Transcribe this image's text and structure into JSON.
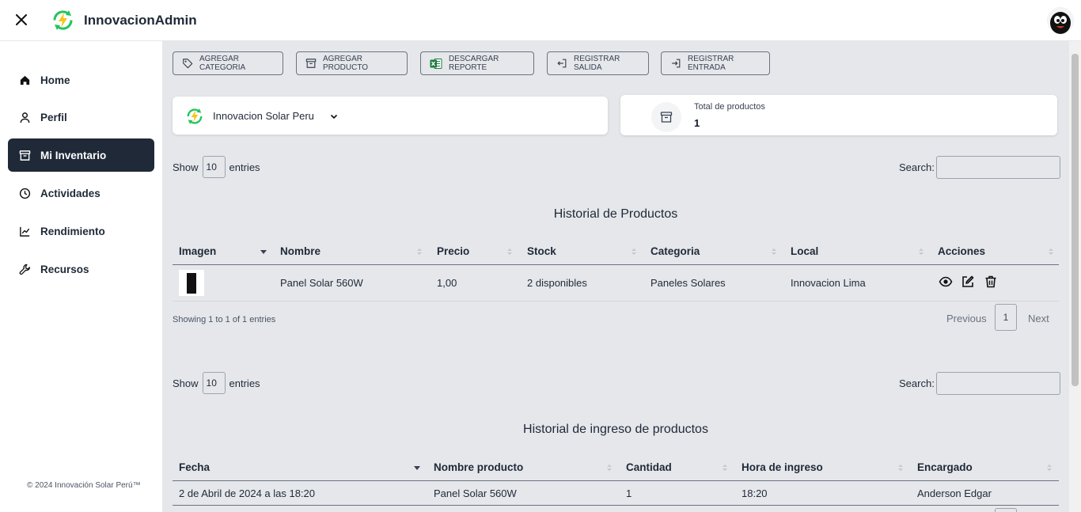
{
  "header": {
    "brand_name": "InnovacionAdmin"
  },
  "sidebar": {
    "items": [
      {
        "label": "Home",
        "icon": "home-icon"
      },
      {
        "label": "Perfil",
        "icon": "user-icon"
      },
      {
        "label": "Mi Inventario",
        "icon": "archive-icon",
        "active": true
      },
      {
        "label": "Actividades",
        "icon": "clock-icon"
      },
      {
        "label": "Rendimiento",
        "icon": "chart-line-icon"
      },
      {
        "label": "Recursos",
        "icon": "wrench-icon"
      }
    ],
    "copyright": "© 2024 Innovación Solar Perú™"
  },
  "toolbar": {
    "buttons": [
      {
        "label": "AGREGAR CATEGORIA",
        "icon": "tag-icon"
      },
      {
        "label": "AGREGAR PRODUCTO",
        "icon": "archive-icon"
      },
      {
        "label": "DESCARGAR REPORTE",
        "icon": "excel-icon"
      },
      {
        "label": "REGISTRAR SALIDA",
        "icon": "logout-icon"
      },
      {
        "label": "REGISTRAR ENTRADA",
        "icon": "login-icon"
      }
    ]
  },
  "company": {
    "name": "Innovacion Solar Peru"
  },
  "total": {
    "label": "Total de productos",
    "value": "1"
  },
  "products_table": {
    "show_label": "Show",
    "length": "10",
    "entries_label": "entries",
    "search_label": "Search:",
    "title": "Historial de Productos",
    "columns": [
      "Imagen",
      "Nombre",
      "Precio",
      "Stock",
      "Categoria",
      "Local",
      "Acciones"
    ],
    "rows": [
      {
        "nombre": "Panel Solar 560W",
        "precio": "1,00",
        "stock": "2 disponibles",
        "categoria": "Paneles Solares",
        "local": "Innovacion Lima"
      }
    ],
    "info": "Showing 1 to 1 of 1 entries",
    "previous": "Previous",
    "page": "1",
    "next": "Next"
  },
  "ingresos_table": {
    "show_label": "Show",
    "length": "10",
    "entries_label": "entries",
    "search_label": "Search:",
    "title": "Historial de ingreso de productos",
    "columns": [
      "Fecha",
      "Nombre producto",
      "Cantidad",
      "Hora de ingreso",
      "Encargado"
    ],
    "rows": [
      {
        "fecha": "2 de Abril de 2024 a las 18:20",
        "nombre": "Panel Solar 560W",
        "cantidad": "1",
        "hora": "18:20",
        "encargado": "Anderson Edgar"
      }
    ]
  },
  "colors": {
    "sidebar_active_bg": "#1f2937",
    "main_bg": "#e5e7eb",
    "excel_green": "#1d7a3e",
    "logo_green": "#22c55e",
    "logo_yellow": "#f5c518"
  }
}
